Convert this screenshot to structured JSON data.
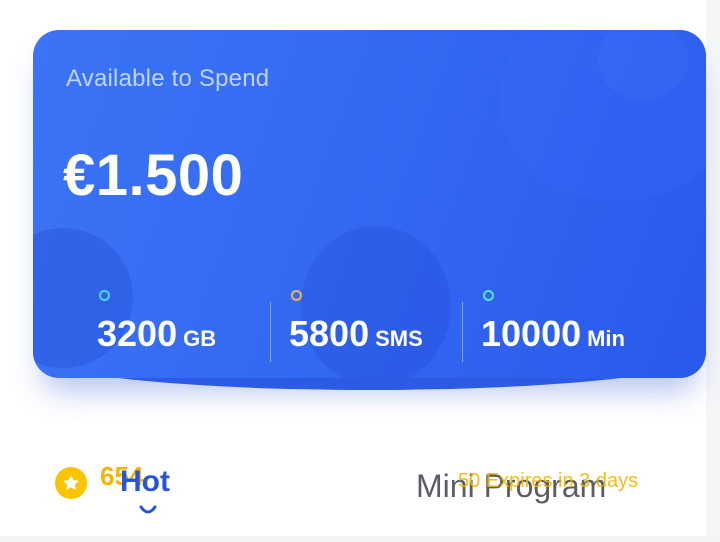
{
  "card": {
    "label": "Available to Spend",
    "amount": "€1.500",
    "stats": [
      {
        "value": "3200",
        "unit": "GB",
        "dot_color": "#4fd3f0"
      },
      {
        "value": "5800",
        "unit": "SMS",
        "dot_color": "#f3b24a"
      },
      {
        "value": "10000",
        "unit": "Min",
        "dot_color": "#55e3d8"
      }
    ]
  },
  "points": {
    "value": "654",
    "icon": "star-icon",
    "expires_text": "50 Expires in 3 days"
  },
  "tabs": [
    {
      "label": "Hot",
      "active": true
    },
    {
      "label": "Mini Program",
      "active": false
    }
  ],
  "colors": {
    "card_blue": "#346af2",
    "accent_yellow": "#f5b400",
    "tab_active": "#2655d9"
  }
}
